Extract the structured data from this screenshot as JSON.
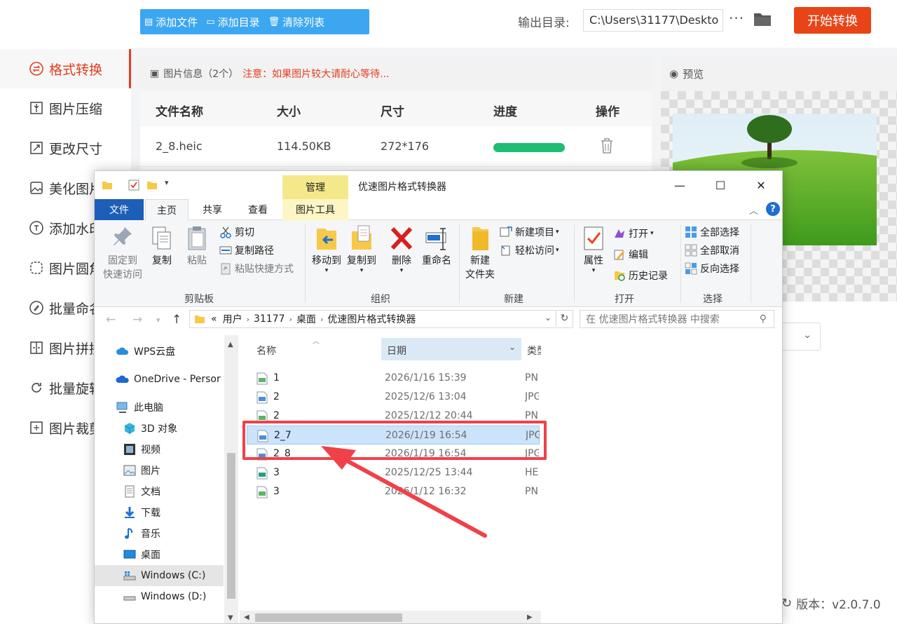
{
  "sidebar": {
    "items": [
      {
        "label": "格式转换",
        "icon": "swap-circle-icon",
        "active": true
      },
      {
        "label": "图片压缩",
        "icon": "compress-icon"
      },
      {
        "label": "更改尺寸",
        "icon": "resize-icon"
      },
      {
        "label": "美化图片",
        "icon": "beautify-icon"
      },
      {
        "label": "添加水印",
        "icon": "watermark-icon"
      },
      {
        "label": "图片圆角",
        "icon": "round-corner-icon"
      },
      {
        "label": "批量命名",
        "icon": "rename-icon"
      },
      {
        "label": "图片拼接",
        "icon": "stitch-icon"
      },
      {
        "label": "批量旋转",
        "icon": "rotate-icon"
      },
      {
        "label": "图片裁剪",
        "icon": "crop-icon"
      }
    ]
  },
  "toolbar": {
    "add_file": "添加文件",
    "add_dir": "添加目录",
    "clear_list": "清除列表",
    "output_label": "输出目录:",
    "output_path": "C:\\Users\\31177\\Deskto",
    "more": "···",
    "start": "开始转换"
  },
  "file_list": {
    "info_label": "图片信息（2个）",
    "warning": "注意：如果图片较大请耐心等待...",
    "headers": [
      "文件名称",
      "大小",
      "尺寸",
      "进度",
      "操作"
    ],
    "rows": [
      {
        "name": "2_8.heic",
        "size": "114.50KB",
        "dims": "272*176",
        "progress": 1.0
      }
    ]
  },
  "preview": {
    "title": "预览"
  },
  "version": "版本：v2.0.7.0",
  "explorer": {
    "manage_tab": "管理",
    "window_title": "优速图片格式转换器",
    "tabs": {
      "file": "文件",
      "home": "主页",
      "share": "共享",
      "view": "查看",
      "picture_tools": "图片工具"
    },
    "ribbon": {
      "clipboard": {
        "label": "剪贴板",
        "pin": [
          "固定到",
          "快速访问"
        ],
        "copy": "复制",
        "paste": "粘贴",
        "cut": "剪切",
        "copy_path": "复制路径",
        "paste_shortcut": "粘贴快捷方式"
      },
      "organize": {
        "label": "组织",
        "move_to": "移动到",
        "copy_to": "复制到",
        "delete": "删除",
        "rename": "重命名"
      },
      "new": {
        "label": "新建",
        "new_folder": [
          "新建",
          "文件夹"
        ],
        "new_item": "新建项目",
        "easy_access": "轻松访问"
      },
      "open": {
        "label": "打开",
        "properties": "属性",
        "open": "打开",
        "edit": "编辑",
        "history": "历史记录"
      },
      "select": {
        "label": "选择",
        "select_all": "全部选择",
        "select_none": "全部取消",
        "invert": "反向选择"
      }
    },
    "address": {
      "prefix": "«",
      "crumbs": [
        "用户",
        "31177",
        "桌面",
        "优速图片格式转换器"
      ],
      "search_placeholder": "在 优速图片格式转换器 中搜索"
    },
    "nav": [
      {
        "label": "WPS云盘",
        "icon": "cloud-icon"
      },
      {
        "label": "OneDrive - Persor",
        "icon": "onedrive-icon"
      },
      {
        "label": "此电脑",
        "icon": "computer-icon"
      },
      {
        "label": "3D 对象",
        "icon": "cube-icon"
      },
      {
        "label": "视频",
        "icon": "video-icon"
      },
      {
        "label": "图片",
        "icon": "picture-icon"
      },
      {
        "label": "文档",
        "icon": "document-icon"
      },
      {
        "label": "下载",
        "icon": "download-icon"
      },
      {
        "label": "音乐",
        "icon": "music-icon"
      },
      {
        "label": "桌面",
        "icon": "desktop-icon"
      },
      {
        "label": "Windows (C:)",
        "icon": "drive-c-icon",
        "selected": true
      },
      {
        "label": "Windows (D:)",
        "icon": "drive-d-icon"
      }
    ],
    "columns": {
      "name": "名称",
      "date": "日期",
      "type": "类型"
    },
    "files": [
      {
        "name": "1",
        "date": "2026/1/16 15:39",
        "type": "PN"
      },
      {
        "name": "2",
        "date": "2025/12/6 13:04",
        "type": "JPG"
      },
      {
        "name": "2",
        "date": "2025/12/12 20:44",
        "type": "PN"
      },
      {
        "name": "2_7",
        "date": "2026/1/19 16:54",
        "type": "JPG",
        "selected": true
      },
      {
        "name": "2_8",
        "date": "2026/1/19 16:54",
        "type": "JPG"
      },
      {
        "name": "3",
        "date": "2025/12/25 13:44",
        "type": "HE"
      },
      {
        "name": "3",
        "date": "2026/1/12 16:32",
        "type": "PN"
      }
    ]
  },
  "colors": {
    "accent_red": "#e84418",
    "toolbar_blue": "#3ca7f0",
    "progress_green": "#1ebd73",
    "highlight": "#f0414a",
    "file_tab_blue": "#1d5eb8"
  }
}
